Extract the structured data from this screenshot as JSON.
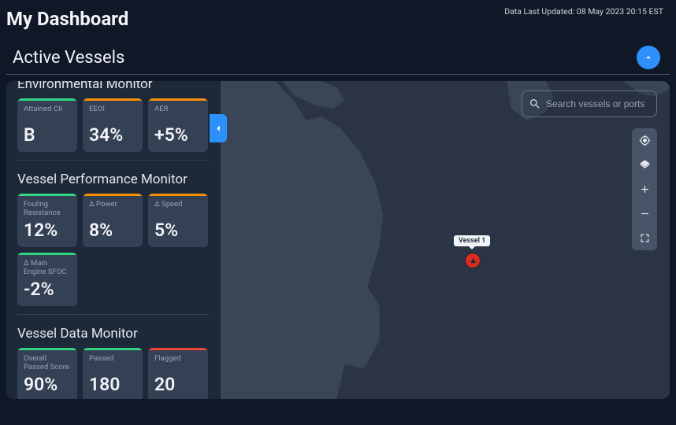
{
  "header": {
    "title": "My Dashboard",
    "last_updated": "Data Last Updated: 08 May 2023 20:15 EST"
  },
  "section": {
    "title": "Active Vessels"
  },
  "sidebar": {
    "groups": [
      {
        "title": "Environmental Monitor",
        "cards": [
          {
            "label": "Attained CII",
            "value": "B",
            "bar": "green"
          },
          {
            "label": "EEOI",
            "value": "34%",
            "bar": "orange"
          },
          {
            "label": "AER",
            "value": "+5%",
            "bar": "orange"
          }
        ]
      },
      {
        "title": "Vessel Performance Monitor",
        "cards": [
          {
            "label": "Fouling Resistance",
            "value": "12%",
            "bar": "green"
          },
          {
            "label": "Δ Power",
            "value": "8%",
            "bar": "orange"
          },
          {
            "label": "Δ  Speed",
            "value": "5%",
            "bar": "orange"
          },
          {
            "label": "Δ Main Engine SFOC",
            "value": "-2%",
            "bar": "green"
          }
        ]
      },
      {
        "title": "Vessel Data Monitor",
        "cards": [
          {
            "label": "Overall Passed Score",
            "value": "90%",
            "bar": "green"
          },
          {
            "label": "Passed",
            "value": "180",
            "bar": "green"
          },
          {
            "label": "Flagged",
            "value": "20",
            "bar": "red"
          }
        ]
      }
    ]
  },
  "map": {
    "search_placeholder": "Search vessels or ports",
    "vessel_label": "Vessel 1"
  }
}
